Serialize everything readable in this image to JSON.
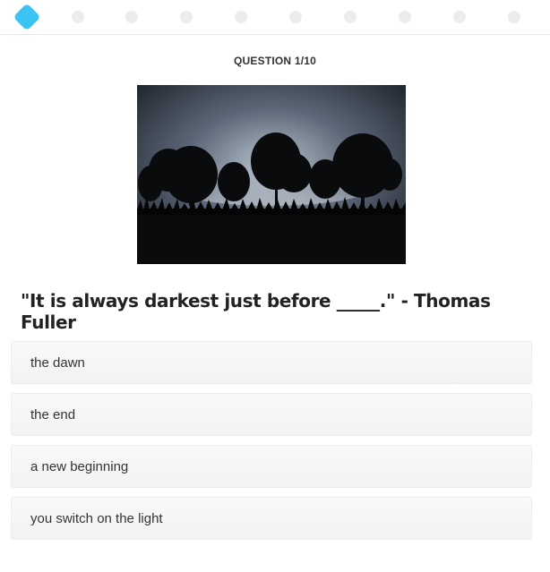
{
  "progress": {
    "total_steps": 10,
    "current_step": 1
  },
  "question": {
    "label": "QUESTION 1/10",
    "image_icon": "dark-forest-silhouette-image",
    "text": "\"It is always darkest just before _____.\" - Thomas Fuller"
  },
  "answers": [
    {
      "label": "the dawn"
    },
    {
      "label": "the end"
    },
    {
      "label": "a new beginning"
    },
    {
      "label": "you switch on the light"
    }
  ],
  "colors": {
    "accent": "#3bc3f3",
    "step_inactive": "#ececec"
  }
}
